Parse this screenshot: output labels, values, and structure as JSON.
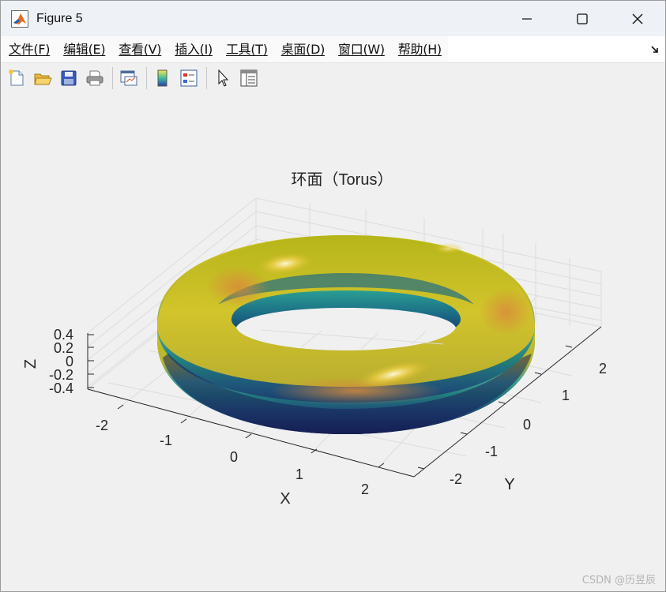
{
  "window": {
    "title": "Figure 5"
  },
  "menu": {
    "items": [
      {
        "label": "文件(F)"
      },
      {
        "label": "编辑(E)"
      },
      {
        "label": "查看(V)"
      },
      {
        "label": "插入(I)"
      },
      {
        "label": "工具(T)"
      },
      {
        "label": "桌面(D)"
      },
      {
        "label": "窗口(W)"
      },
      {
        "label": "帮助(H)"
      }
    ]
  },
  "toolbar": {
    "icons": [
      "new-figure-icon",
      "open-file-icon",
      "save-icon",
      "print-icon",
      "link-plot-icon",
      "colorbar-icon",
      "legend-icon",
      "pointer-icon",
      "property-editor-icon"
    ]
  },
  "plot": {
    "title": "环面（Torus）",
    "xlabel": "X",
    "ylabel": "Y",
    "zlabel": "Z",
    "x_ticks": [
      "-2",
      "-1",
      "0",
      "1",
      "2"
    ],
    "y_ticks": [
      "-2",
      "-1",
      "0",
      "1",
      "2"
    ],
    "z_ticks": [
      "0.4",
      "0.2",
      "0",
      "-0.2",
      "-0.4"
    ],
    "colormap": "parula",
    "surface": "torus",
    "grid": true
  },
  "watermark": "CSDN @历昱辰"
}
